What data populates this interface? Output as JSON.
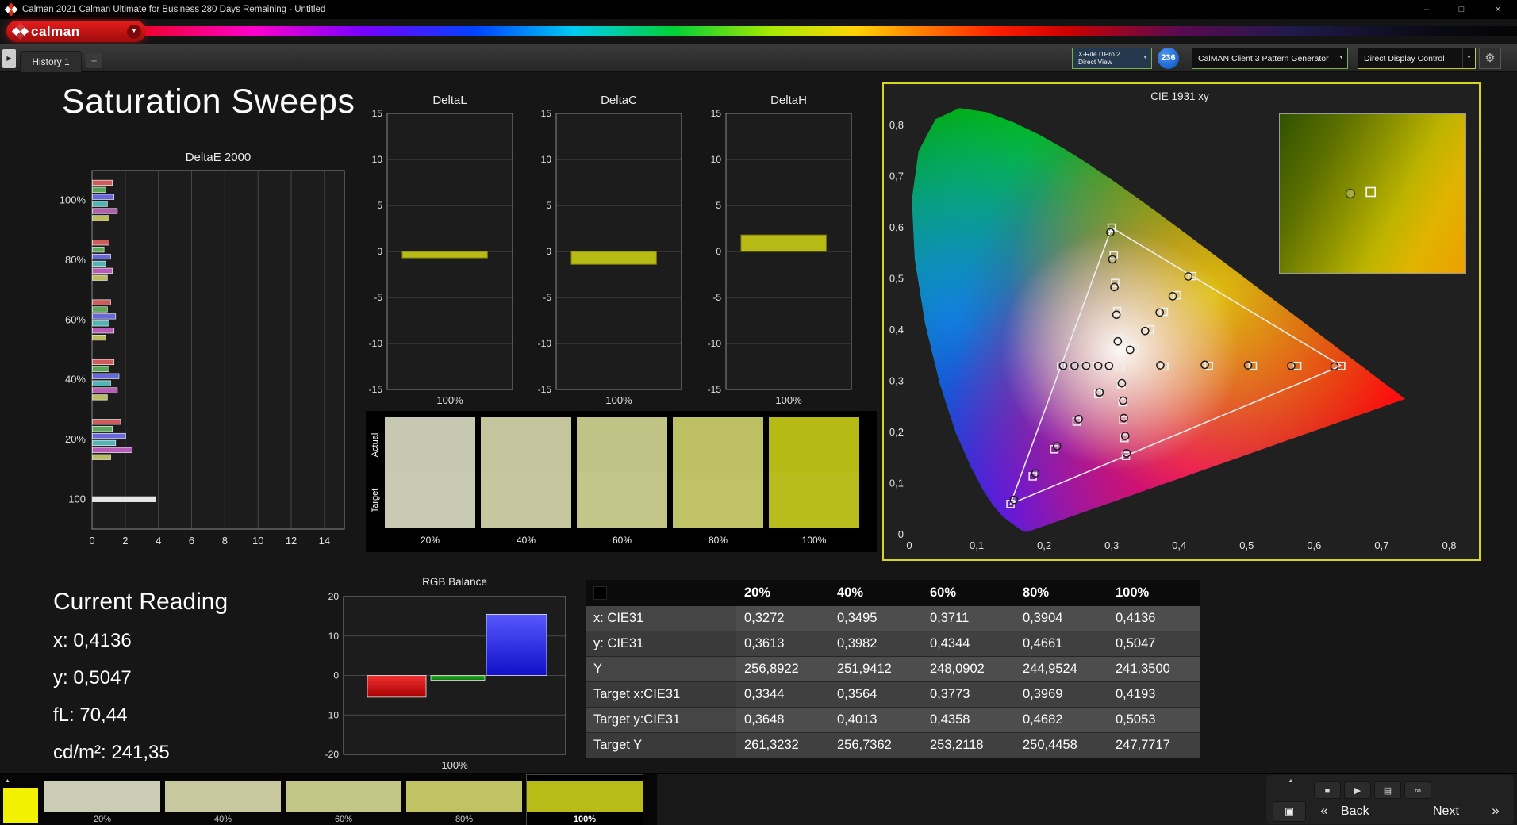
{
  "window": {
    "title": "Calman 2021 Calman Ultimate for Business 280 Days Remaining  - Untitled",
    "controls": {
      "minimize": "–",
      "maximize": "□",
      "close": "×"
    }
  },
  "brand": {
    "logo_text": "calman",
    "menu_arrow": "▼"
  },
  "toolbar": {
    "history_expand": "▶",
    "tab": "History 1",
    "add_tab": "+",
    "meter_line1": "X-Rite i1Pro 2",
    "meter_line2": "Direct View",
    "badge": "236",
    "pattern_generator": "CalMAN Client 3 Pattern Generator",
    "display_control": "Direct Display Control",
    "dropdown_arrow": "▼",
    "gear": "⚙"
  },
  "page_title": "Saturation Sweeps",
  "current_reading": {
    "title": "Current Reading",
    "lines": [
      "x: 0,4136",
      "y: 0,5047",
      "fL: 70,44",
      "cd/m²: 241,35"
    ]
  },
  "swatch_panel": {
    "row_labels": [
      "Actual",
      "Target"
    ],
    "columns": [
      {
        "label": "20%",
        "actual": "#c6c8b1",
        "target": "#c9cab3"
      },
      {
        "label": "40%",
        "actual": "#c4c59c",
        "target": "#c6c79f"
      },
      {
        "label": "60%",
        "actual": "#c1c386",
        "target": "#c3c589"
      },
      {
        "label": "80%",
        "actual": "#bdc062",
        "target": "#bfc266"
      },
      {
        "label": "100%",
        "actual": "#b6ba15",
        "target": "#b9bc1c"
      }
    ]
  },
  "results_table": {
    "columns": [
      "",
      "20%",
      "40%",
      "60%",
      "80%",
      "100%"
    ],
    "rows": [
      {
        "label": "x: CIE31",
        "values": [
          "0,3272",
          "0,3495",
          "0,3711",
          "0,3904",
          "0,4136"
        ]
      },
      {
        "label": "y: CIE31",
        "values": [
          "0,3613",
          "0,3982",
          "0,4344",
          "0,4661",
          "0,5047"
        ]
      },
      {
        "label": "Y",
        "values": [
          "256,8922",
          "251,9412",
          "248,0902",
          "244,9524",
          "241,3500"
        ]
      },
      {
        "label": "Target x:CIE31",
        "values": [
          "0,3344",
          "0,3564",
          "0,3773",
          "0,3969",
          "0,4193"
        ]
      },
      {
        "label": "Target y:CIE31",
        "values": [
          "0,3648",
          "0,4013",
          "0,4358",
          "0,4682",
          "0,5053"
        ]
      },
      {
        "label": "Target Y",
        "values": [
          "261,3232",
          "256,7362",
          "253,2118",
          "250,4458",
          "247,7717"
        ]
      }
    ]
  },
  "bottom_bar": {
    "pattern_color": "#f2f200",
    "swatches": [
      {
        "label": "20%",
        "color": "#caccb3"
      },
      {
        "label": "40%",
        "color": "#c7c89e"
      },
      {
        "label": "60%",
        "color": "#c4c687"
      },
      {
        "label": "80%",
        "color": "#c0c263"
      },
      {
        "label": "100%",
        "color": "#b9bc17"
      }
    ],
    "selected": "100%",
    "controls": {
      "panel_up": "▲",
      "stop": "■",
      "play": "▶",
      "save": "▤",
      "continuous": "∞",
      "pattern_window": "▣",
      "prev": "«",
      "next": "»"
    },
    "back_label": "Back",
    "next_label": "Next"
  },
  "chart_data": [
    {
      "id": "deltae2000",
      "type": "bar",
      "orientation": "horizontal",
      "title": "DeltaE 2000",
      "xlim": [
        0,
        15.2
      ],
      "xticks": [
        0,
        2,
        4,
        6,
        8,
        10,
        12,
        14
      ],
      "bar_colors": [
        "#cf5c5c",
        "#5aa85a",
        "#6868da",
        "#52b4b4",
        "#b75cb7",
        "#bcbc5e"
      ],
      "groups": [
        {
          "label": "100%",
          "values": [
            1.2,
            0.8,
            1.3,
            0.9,
            1.5,
            1.0
          ]
        },
        {
          "label": "80%",
          "values": [
            1.0,
            0.7,
            1.1,
            0.8,
            1.2,
            0.9
          ]
        },
        {
          "label": "60%",
          "values": [
            1.1,
            0.9,
            1.4,
            1.0,
            1.3,
            0.8
          ]
        },
        {
          "label": "40%",
          "values": [
            1.3,
            1.0,
            1.6,
            1.1,
            1.5,
            0.9
          ]
        },
        {
          "label": "20%",
          "values": [
            1.7,
            1.2,
            2.0,
            1.4,
            2.4,
            1.1
          ]
        },
        {
          "label": "100",
          "values": [
            3.8
          ],
          "colors": [
            "#e6e6e6"
          ]
        }
      ]
    },
    {
      "id": "deltaL",
      "type": "bar",
      "title": "DeltaL",
      "ylim": [
        -15,
        15
      ],
      "yticks": [
        15,
        10,
        5,
        0,
        -5,
        -10,
        -15
      ],
      "value": -0.7,
      "bar_color": "#b8ba16",
      "xlabel": "100%"
    },
    {
      "id": "deltaC",
      "type": "bar",
      "title": "DeltaC",
      "ylim": [
        -15,
        15
      ],
      "yticks": [
        15,
        10,
        5,
        0,
        -5,
        -10,
        -15
      ],
      "value": -1.4,
      "bar_color": "#b8ba16",
      "xlabel": "100%"
    },
    {
      "id": "deltaH",
      "type": "bar",
      "title": "DeltaH",
      "ylim": [
        -15,
        15
      ],
      "yticks": [
        15,
        10,
        5,
        0,
        -5,
        -10,
        -15
      ],
      "value": 1.8,
      "bar_color": "#b8ba16",
      "xlabel": "100%"
    },
    {
      "id": "rgb_balance",
      "type": "bar",
      "title": "RGB Balance",
      "ylim": [
        -20,
        20
      ],
      "yticks": [
        20,
        10,
        0,
        -10,
        -20
      ],
      "xlabel": "100%",
      "series": [
        {
          "name": "Red",
          "value": -5.5,
          "color": "#e01414"
        },
        {
          "name": "Green",
          "value": -1.2,
          "color": "#189818"
        },
        {
          "name": "Blue",
          "value": 15.5,
          "color": "#2a2af0"
        }
      ]
    },
    {
      "id": "cie1931",
      "type": "scatter",
      "title": "CIE 1931 xy",
      "xlim": [
        0,
        0.81
      ],
      "ylim": [
        0,
        0.828
      ],
      "ticks": [
        0,
        0.1,
        0.2,
        0.3,
        0.4,
        0.5,
        0.6,
        0.7,
        0.8
      ],
      "tick_labels": [
        "0",
        "0,1",
        "0,2",
        "0,3",
        "0,4",
        "0,5",
        "0,6",
        "0,7",
        "0,8"
      ],
      "white_point": [
        0.3127,
        0.329
      ],
      "gamut_triangle": [
        [
          0.64,
          0.33
        ],
        [
          0.3,
          0.6
        ],
        [
          0.15,
          0.06
        ]
      ],
      "sweeps": [
        {
          "name": "red",
          "targets": [
            [
              0.378,
              0.329
            ],
            [
              0.444,
              0.33
            ],
            [
              0.509,
              0.33
            ],
            [
              0.575,
              0.33
            ],
            [
              0.64,
              0.33
            ]
          ],
          "measured": [
            [
              0.372,
              0.331
            ],
            [
              0.438,
              0.332
            ],
            [
              0.502,
              0.331
            ],
            [
              0.566,
              0.33
            ],
            [
              0.63,
              0.329
            ]
          ]
        },
        {
          "name": "green",
          "targets": [
            [
              0.31,
              0.383
            ],
            [
              0.308,
              0.437
            ],
            [
              0.305,
              0.492
            ],
            [
              0.303,
              0.546
            ],
            [
              0.3,
              0.6
            ]
          ],
          "measured": [
            [
              0.309,
              0.378
            ],
            [
              0.307,
              0.43
            ],
            [
              0.304,
              0.484
            ],
            [
              0.301,
              0.538
            ],
            [
              0.298,
              0.591
            ]
          ]
        },
        {
          "name": "blue",
          "targets": [
            [
              0.28,
              0.275
            ],
            [
              0.248,
              0.221
            ],
            [
              0.215,
              0.167
            ],
            [
              0.183,
              0.114
            ],
            [
              0.15,
              0.06
            ]
          ],
          "measured": [
            [
              0.282,
              0.278
            ],
            [
              0.251,
              0.226
            ],
            [
              0.219,
              0.173
            ],
            [
              0.187,
              0.12
            ],
            [
              0.155,
              0.068
            ]
          ]
        },
        {
          "name": "cyan",
          "targets": [
            [
              0.295,
              0.329
            ],
            [
              0.278,
              0.329
            ],
            [
              0.26,
              0.329
            ],
            [
              0.243,
              0.329
            ],
            [
              0.225,
              0.329
            ]
          ],
          "measured": [
            [
              0.296,
              0.33
            ],
            [
              0.28,
              0.33
            ],
            [
              0.262,
              0.33
            ],
            [
              0.245,
              0.33
            ],
            [
              0.228,
              0.33
            ]
          ]
        },
        {
          "name": "magenta",
          "targets": [
            [
              0.314,
              0.294
            ],
            [
              0.316,
              0.259
            ],
            [
              0.317,
              0.224
            ],
            [
              0.319,
              0.189
            ],
            [
              0.321,
              0.154
            ]
          ],
          "measured": [
            [
              0.315,
              0.296
            ],
            [
              0.317,
              0.262
            ],
            [
              0.318,
              0.228
            ],
            [
              0.32,
              0.193
            ],
            [
              0.322,
              0.159
            ]
          ]
        },
        {
          "name": "yellow",
          "targets": [
            [
              0.3344,
              0.3648
            ],
            [
              0.3564,
              0.4013
            ],
            [
              0.3773,
              0.4358
            ],
            [
              0.3969,
              0.4682
            ],
            [
              0.4193,
              0.5053
            ]
          ],
          "measured": [
            [
              0.3272,
              0.3613
            ],
            [
              0.3495,
              0.3982
            ],
            [
              0.3711,
              0.4344
            ],
            [
              0.3904,
              0.4661
            ],
            [
              0.4136,
              0.5047
            ]
          ]
        }
      ],
      "inset_points": {
        "circle": [
          0.38,
          0.5
        ],
        "square": [
          0.49,
          0.49
        ]
      }
    }
  ]
}
